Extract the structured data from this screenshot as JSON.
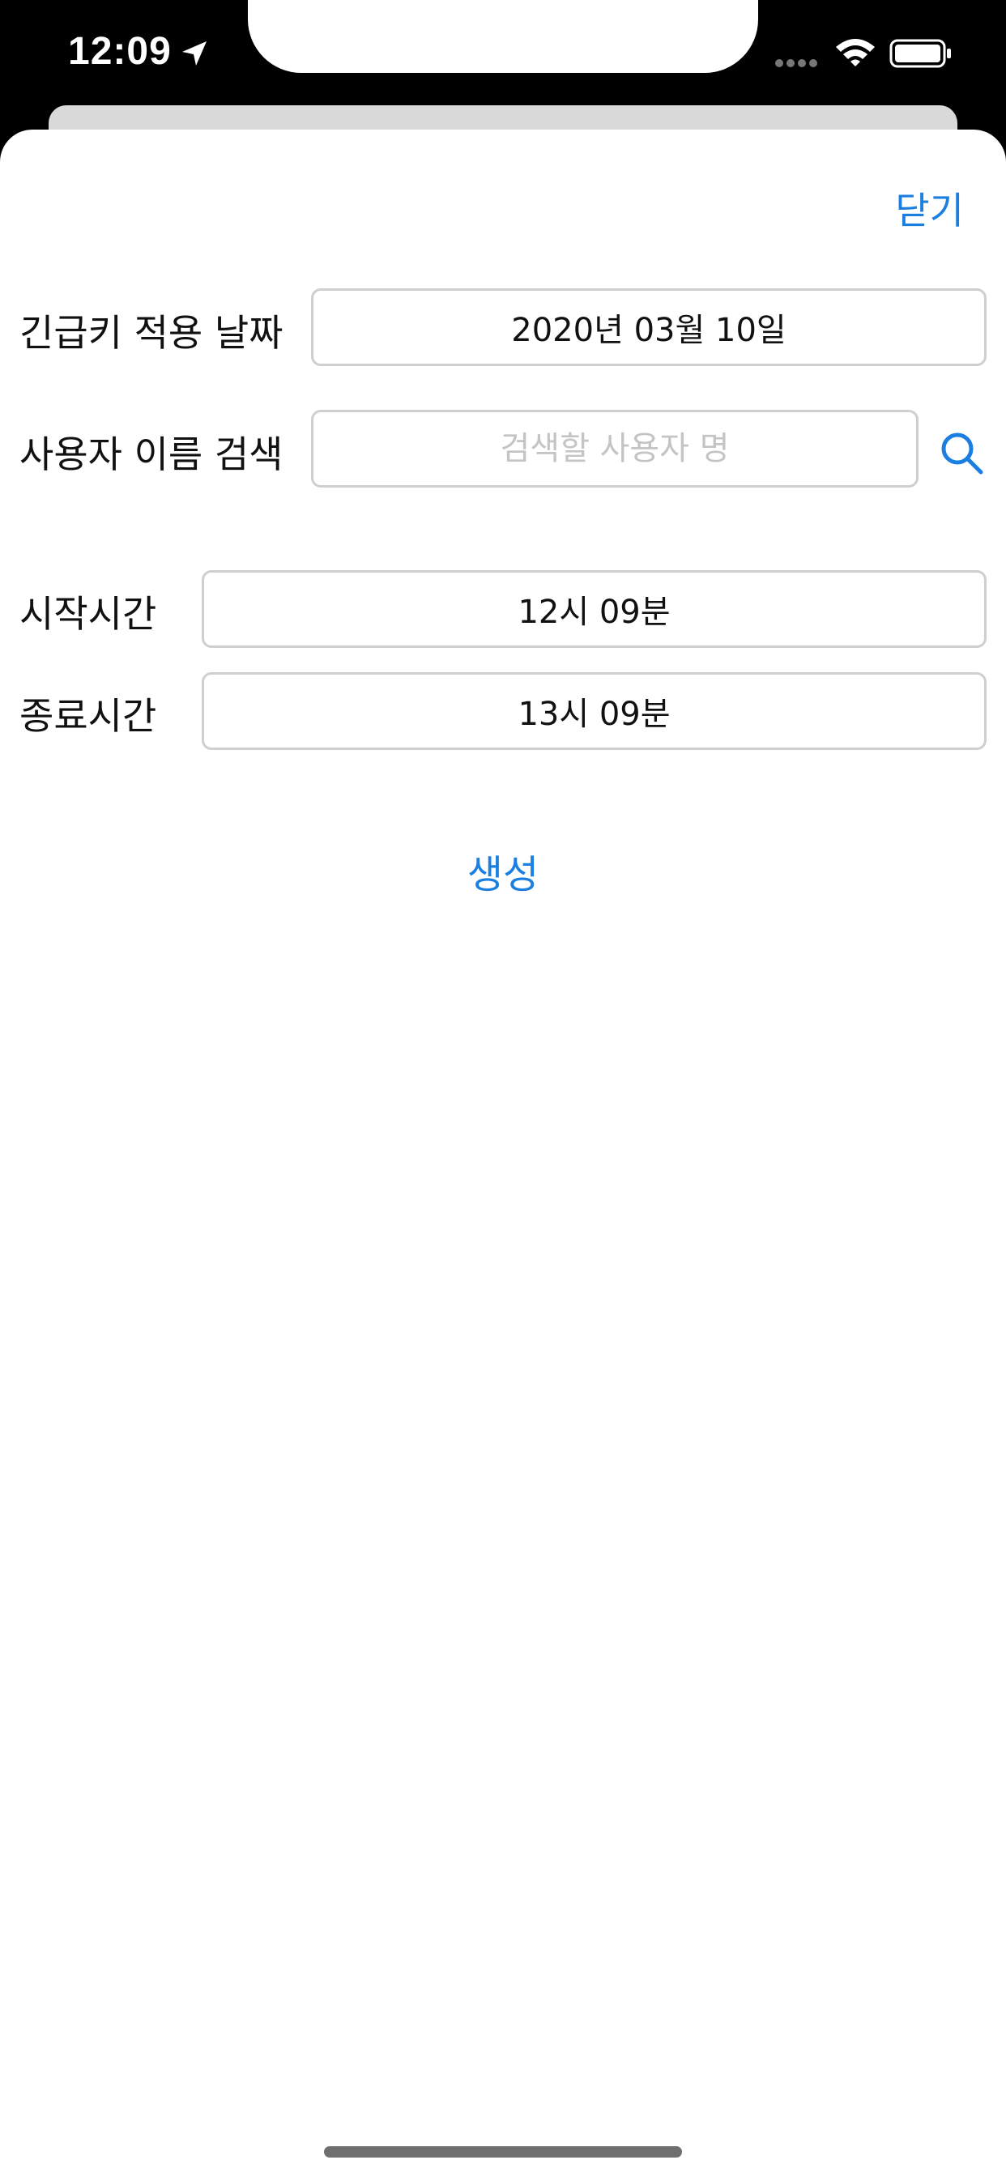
{
  "status_bar": {
    "time": "12:09",
    "icons": [
      "location-arrow-icon",
      "signal-dots-icon",
      "wifi-icon",
      "battery-icon"
    ]
  },
  "header": {
    "close_label": "닫기"
  },
  "form": {
    "date_label": "긴급키 적용 날짜",
    "date_value": "2020년 03월 10일",
    "user_label": "사용자 이름 검색",
    "user_placeholder": "검색할 사용자 명",
    "user_value": "",
    "start_label": "시작시간",
    "start_value": "12시 09분",
    "end_label": "종료시간",
    "end_value": "13시 09분"
  },
  "actions": {
    "create_label": "생성"
  },
  "colors": {
    "accent": "#1a7fe0",
    "border": "#cfcfcf",
    "placeholder": "#c4c4c4"
  }
}
